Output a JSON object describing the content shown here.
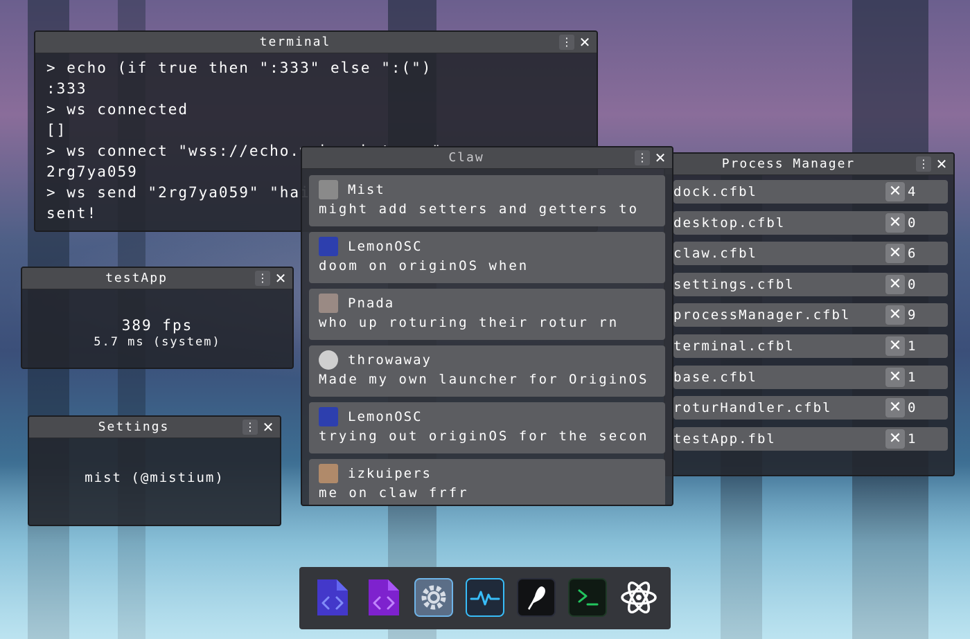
{
  "terminal": {
    "title": "terminal",
    "lines": [
      "> echo (if true then \":333\" else \":(\")",
      ":333",
      "> ws connected",
      "[]",
      "> ws connect \"wss://echo.websocket.org\"",
      "2rg7ya059",
      "> ws send \"2rg7ya059\" \"haii :3\"",
      "sent!"
    ]
  },
  "testApp": {
    "title": "testApp",
    "fps": "389 fps",
    "ms": "5.7 ms (system)"
  },
  "settings": {
    "title": "Settings",
    "user": "mist (@mistium)"
  },
  "claw": {
    "title": "Claw",
    "messages": [
      {
        "user": "Mist",
        "text": "might add setters and getters to"
      },
      {
        "user": "LemonOSC",
        "text": "doom on originOS when"
      },
      {
        "user": "Pnada",
        "text": "who up roturing their rotur rn"
      },
      {
        "user": "throwaway",
        "text": "Made my own launcher for OriginOS"
      },
      {
        "user": "LemonOSC",
        "text": "trying out originOS for the secon"
      },
      {
        "user": "izkuipers",
        "text": "me on claw frfr"
      }
    ]
  },
  "processManager": {
    "title": "Process Manager",
    "processes": [
      {
        "name": "dock.cfbl",
        "count": "4"
      },
      {
        "name": "desktop.cfbl",
        "count": "0"
      },
      {
        "name": "claw.cfbl",
        "count": "6"
      },
      {
        "name": "settings.cfbl",
        "count": "0"
      },
      {
        "name": "processManager.cfbl",
        "count": "9"
      },
      {
        "name": "terminal.cfbl",
        "count": "1"
      },
      {
        "name": "base.cfbl",
        "count": "1"
      },
      {
        "name": "roturHandler.cfbl",
        "count": "0"
      },
      {
        "name": "testApp.fbl",
        "count": "1"
      }
    ]
  },
  "dock": {
    "items": [
      {
        "icon": "code-file-blue-icon"
      },
      {
        "icon": "code-file-purple-icon"
      },
      {
        "icon": "settings-gear-icon"
      },
      {
        "icon": "activity-pulse-icon"
      },
      {
        "icon": "quill-pen-icon"
      },
      {
        "icon": "terminal-prompt-icon"
      },
      {
        "icon": "atom-icon"
      }
    ]
  },
  "colors": {
    "accent_blue": "#4f46e5",
    "accent_purple": "#7c3aed",
    "accent_cyan": "#38bdf8",
    "terminal_green": "#22c55e"
  }
}
